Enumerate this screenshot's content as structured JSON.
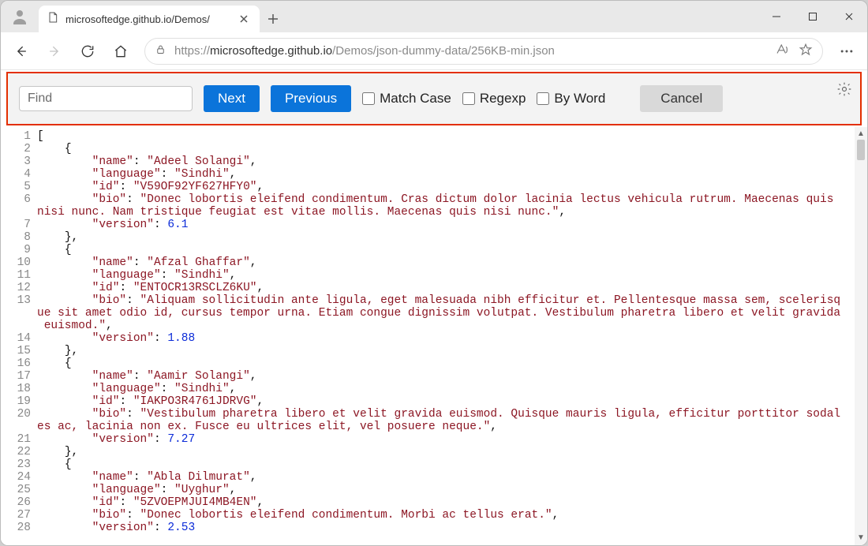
{
  "window": {
    "min": "",
    "max": "",
    "close": ""
  },
  "tab": {
    "title": "microsoftedge.github.io/Demos/"
  },
  "addr": {
    "scheme": "https://",
    "host": "microsoftedge.github.io",
    "path": "/Demos/json-dummy-data/256KB-min.json"
  },
  "find": {
    "placeholder": "Find",
    "next": "Next",
    "previous": "Previous",
    "match_case": "Match Case",
    "regexp": "Regexp",
    "by_word": "By Word",
    "cancel": "Cancel"
  },
  "code": {
    "lines": [
      {
        "n": "1",
        "seg": [
          {
            "t": "[",
            "c": "p"
          }
        ]
      },
      {
        "n": "2",
        "seg": [
          {
            "t": "    {",
            "c": "p"
          }
        ]
      },
      {
        "n": "3",
        "seg": [
          {
            "t": "        ",
            "c": "p"
          },
          {
            "t": "\"name\"",
            "c": "k"
          },
          {
            "t": ": ",
            "c": "p"
          },
          {
            "t": "\"Adeel Solangi\"",
            "c": "s"
          },
          {
            "t": ",",
            "c": "p"
          }
        ]
      },
      {
        "n": "4",
        "seg": [
          {
            "t": "        ",
            "c": "p"
          },
          {
            "t": "\"language\"",
            "c": "k"
          },
          {
            "t": ": ",
            "c": "p"
          },
          {
            "t": "\"Sindhi\"",
            "c": "s"
          },
          {
            "t": ",",
            "c": "p"
          }
        ]
      },
      {
        "n": "5",
        "seg": [
          {
            "t": "        ",
            "c": "p"
          },
          {
            "t": "\"id\"",
            "c": "k"
          },
          {
            "t": ": ",
            "c": "p"
          },
          {
            "t": "\"V59OF92YF627HFY0\"",
            "c": "s"
          },
          {
            "t": ",",
            "c": "p"
          }
        ]
      },
      {
        "n": "6",
        "seg": [
          {
            "t": "        ",
            "c": "p"
          },
          {
            "t": "\"bio\"",
            "c": "k"
          },
          {
            "t": ": ",
            "c": "p"
          },
          {
            "t": "\"Donec lobortis eleifend condimentum. Cras dictum dolor lacinia lectus vehicula rutrum. Maecenas quis nisi nunc. Nam tristique feugiat est vitae mollis. Maecenas quis nisi nunc.\"",
            "c": "s"
          },
          {
            "t": ",",
            "c": "p"
          }
        ]
      },
      {
        "n": "7",
        "seg": [
          {
            "t": "        ",
            "c": "p"
          },
          {
            "t": "\"version\"",
            "c": "k"
          },
          {
            "t": ": ",
            "c": "p"
          },
          {
            "t": "6.1",
            "c": "n"
          }
        ]
      },
      {
        "n": "8",
        "seg": [
          {
            "t": "    },",
            "c": "p"
          }
        ]
      },
      {
        "n": "9",
        "seg": [
          {
            "t": "    {",
            "c": "p"
          }
        ]
      },
      {
        "n": "10",
        "seg": [
          {
            "t": "        ",
            "c": "p"
          },
          {
            "t": "\"name\"",
            "c": "k"
          },
          {
            "t": ": ",
            "c": "p"
          },
          {
            "t": "\"Afzal Ghaffar\"",
            "c": "s"
          },
          {
            "t": ",",
            "c": "p"
          }
        ]
      },
      {
        "n": "11",
        "seg": [
          {
            "t": "        ",
            "c": "p"
          },
          {
            "t": "\"language\"",
            "c": "k"
          },
          {
            "t": ": ",
            "c": "p"
          },
          {
            "t": "\"Sindhi\"",
            "c": "s"
          },
          {
            "t": ",",
            "c": "p"
          }
        ]
      },
      {
        "n": "12",
        "seg": [
          {
            "t": "        ",
            "c": "p"
          },
          {
            "t": "\"id\"",
            "c": "k"
          },
          {
            "t": ": ",
            "c": "p"
          },
          {
            "t": "\"ENTOCR13RSCLZ6KU\"",
            "c": "s"
          },
          {
            "t": ",",
            "c": "p"
          }
        ]
      },
      {
        "n": "13",
        "seg": [
          {
            "t": "        ",
            "c": "p"
          },
          {
            "t": "\"bio\"",
            "c": "k"
          },
          {
            "t": ": ",
            "c": "p"
          },
          {
            "t": "\"Aliquam sollicitudin ante ligula, eget malesuada nibh efficitur et. Pellentesque massa sem, scelerisque sit amet odio id, cursus tempor urna. Etiam congue dignissim volutpat. Vestibulum pharetra libero et velit gravida euismod.\"",
            "c": "s"
          },
          {
            "t": ",",
            "c": "p"
          }
        ]
      },
      {
        "n": "14",
        "seg": [
          {
            "t": "        ",
            "c": "p"
          },
          {
            "t": "\"version\"",
            "c": "k"
          },
          {
            "t": ": ",
            "c": "p"
          },
          {
            "t": "1.88",
            "c": "n"
          }
        ]
      },
      {
        "n": "15",
        "seg": [
          {
            "t": "    },",
            "c": "p"
          }
        ]
      },
      {
        "n": "16",
        "seg": [
          {
            "t": "    {",
            "c": "p"
          }
        ]
      },
      {
        "n": "17",
        "seg": [
          {
            "t": "        ",
            "c": "p"
          },
          {
            "t": "\"name\"",
            "c": "k"
          },
          {
            "t": ": ",
            "c": "p"
          },
          {
            "t": "\"Aamir Solangi\"",
            "c": "s"
          },
          {
            "t": ",",
            "c": "p"
          }
        ]
      },
      {
        "n": "18",
        "seg": [
          {
            "t": "        ",
            "c": "p"
          },
          {
            "t": "\"language\"",
            "c": "k"
          },
          {
            "t": ": ",
            "c": "p"
          },
          {
            "t": "\"Sindhi\"",
            "c": "s"
          },
          {
            "t": ",",
            "c": "p"
          }
        ]
      },
      {
        "n": "19",
        "seg": [
          {
            "t": "        ",
            "c": "p"
          },
          {
            "t": "\"id\"",
            "c": "k"
          },
          {
            "t": ": ",
            "c": "p"
          },
          {
            "t": "\"IAKPO3R4761JDRVG\"",
            "c": "s"
          },
          {
            "t": ",",
            "c": "p"
          }
        ]
      },
      {
        "n": "20",
        "seg": [
          {
            "t": "        ",
            "c": "p"
          },
          {
            "t": "\"bio\"",
            "c": "k"
          },
          {
            "t": ": ",
            "c": "p"
          },
          {
            "t": "\"Vestibulum pharetra libero et velit gravida euismod. Quisque mauris ligula, efficitur porttitor sodales ac, lacinia non ex. Fusce eu ultrices elit, vel posuere neque.\"",
            "c": "s"
          },
          {
            "t": ",",
            "c": "p"
          }
        ]
      },
      {
        "n": "21",
        "seg": [
          {
            "t": "        ",
            "c": "p"
          },
          {
            "t": "\"version\"",
            "c": "k"
          },
          {
            "t": ": ",
            "c": "p"
          },
          {
            "t": "7.27",
            "c": "n"
          }
        ]
      },
      {
        "n": "22",
        "seg": [
          {
            "t": "    },",
            "c": "p"
          }
        ]
      },
      {
        "n": "23",
        "seg": [
          {
            "t": "    {",
            "c": "p"
          }
        ]
      },
      {
        "n": "24",
        "seg": [
          {
            "t": "        ",
            "c": "p"
          },
          {
            "t": "\"name\"",
            "c": "k"
          },
          {
            "t": ": ",
            "c": "p"
          },
          {
            "t": "\"Abla Dilmurat\"",
            "c": "s"
          },
          {
            "t": ",",
            "c": "p"
          }
        ]
      },
      {
        "n": "25",
        "seg": [
          {
            "t": "        ",
            "c": "p"
          },
          {
            "t": "\"language\"",
            "c": "k"
          },
          {
            "t": ": ",
            "c": "p"
          },
          {
            "t": "\"Uyghur\"",
            "c": "s"
          },
          {
            "t": ",",
            "c": "p"
          }
        ]
      },
      {
        "n": "26",
        "seg": [
          {
            "t": "        ",
            "c": "p"
          },
          {
            "t": "\"id\"",
            "c": "k"
          },
          {
            "t": ": ",
            "c": "p"
          },
          {
            "t": "\"5ZVOEPMJUI4MB4EN\"",
            "c": "s"
          },
          {
            "t": ",",
            "c": "p"
          }
        ]
      },
      {
        "n": "27",
        "seg": [
          {
            "t": "        ",
            "c": "p"
          },
          {
            "t": "\"bio\"",
            "c": "k"
          },
          {
            "t": ": ",
            "c": "p"
          },
          {
            "t": "\"Donec lobortis eleifend condimentum. Morbi ac tellus erat.\"",
            "c": "s"
          },
          {
            "t": ",",
            "c": "p"
          }
        ]
      },
      {
        "n": "28",
        "seg": [
          {
            "t": "        ",
            "c": "p"
          },
          {
            "t": "\"version\"",
            "c": "k"
          },
          {
            "t": ": ",
            "c": "p"
          },
          {
            "t": "2.53",
            "c": "n"
          }
        ]
      }
    ]
  }
}
